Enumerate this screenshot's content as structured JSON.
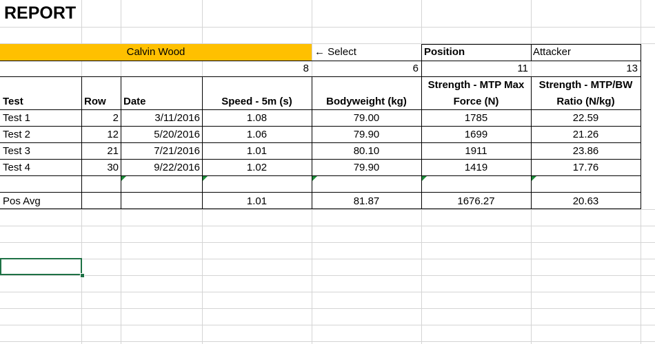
{
  "report_title": "REPORT",
  "selected_player": "Calvin Wood",
  "select_hint": "← Select",
  "position_label": "Position",
  "position_value": "Attacker",
  "column_indexes": [
    "8",
    "6",
    "11",
    "13"
  ],
  "headers": {
    "test": "Test",
    "row": "Row",
    "date": "Date",
    "speed": "Speed - 5m (s)",
    "bodyweight": "Bodyweight (kg)",
    "strength_max_line1": "Strength - MTP Max",
    "strength_max_line2": "Force (N)",
    "strength_ratio_line1": "Strength - MTP/BW",
    "strength_ratio_line2": "Ratio (N/kg)"
  },
  "rows": [
    {
      "test": "Test 1",
      "row": "2",
      "date": "3/11/2016",
      "speed": "1.08",
      "bodyweight": "79.00",
      "max_force": "1785",
      "ratio": "22.59"
    },
    {
      "test": "Test 2",
      "row": "12",
      "date": "5/20/2016",
      "speed": "1.06",
      "bodyweight": "79.90",
      "max_force": "1699",
      "ratio": "21.26"
    },
    {
      "test": "Test 3",
      "row": "21",
      "date": "7/21/2016",
      "speed": "1.01",
      "bodyweight": "80.10",
      "max_force": "1911",
      "ratio": "23.86"
    },
    {
      "test": "Test 4",
      "row": "30",
      "date": "9/22/2016",
      "speed": "1.02",
      "bodyweight": "79.90",
      "max_force": "1419",
      "ratio": "17.76"
    }
  ],
  "average": {
    "label": "Pos Avg",
    "speed": "1.01",
    "bodyweight": "81.87",
    "max_force": "1676.27",
    "ratio": "20.63"
  },
  "colors": {
    "name_band": "#ffc000",
    "gridline": "#d4d4d4",
    "selection": "#1e7145",
    "error_triangle": "#1e8c3a"
  }
}
